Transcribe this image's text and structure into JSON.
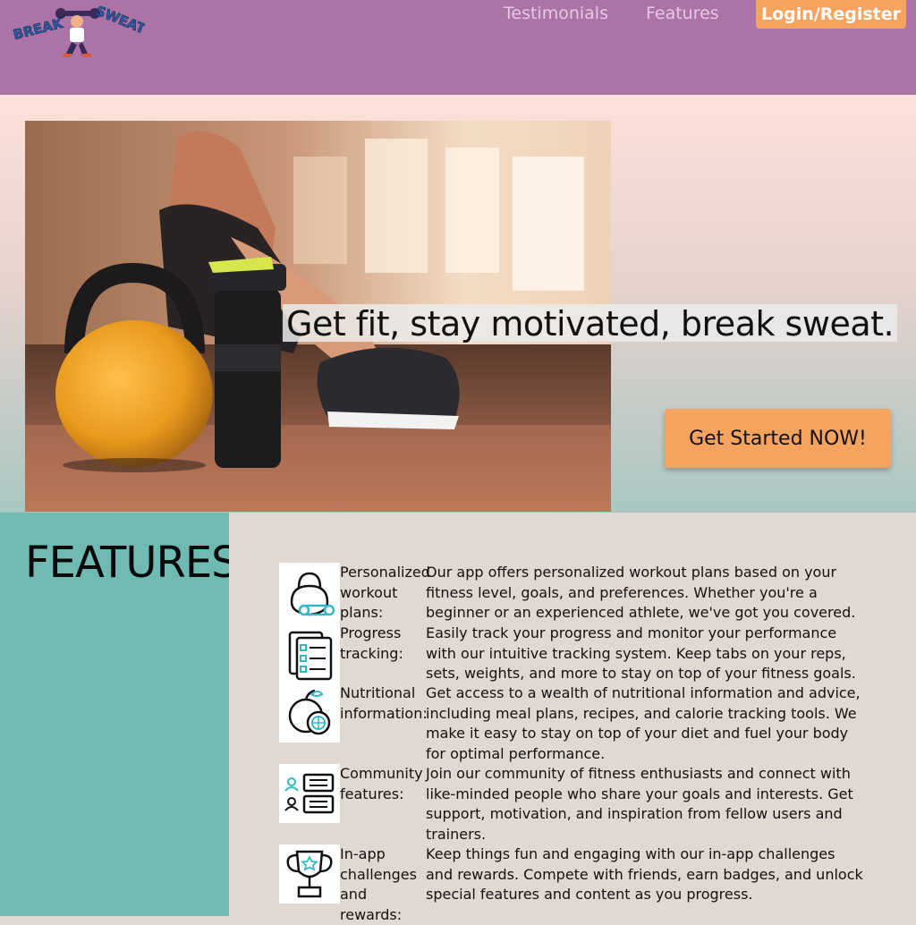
{
  "header": {
    "logo_text_left": "BREAK",
    "logo_text_right": "SWEAT",
    "nav": [
      {
        "label": "Testimonials"
      },
      {
        "label": "Features"
      }
    ],
    "login_label": "Login/Register",
    "accent_color": "#f5a35f",
    "bg_color": "#ab73a6"
  },
  "hero": {
    "tagline": "Get fit, stay motivated, break sweat.",
    "cta_label": "Get Started NOW!"
  },
  "features": {
    "title": "FEATURES",
    "items": [
      {
        "icon": "kettlebell-icon",
        "name": "Personalized workout plans:",
        "description": "Our app offers personalized workout plans based on your fitness level, goals, and preferences. Whether you're a beginner or an experienced athlete, we've got you covered."
      },
      {
        "icon": "clipboard-checklist-icon",
        "name": "Progress tracking:",
        "description": "Easily track your progress and monitor your performance with our intuitive tracking system. Keep tabs on your reps, sets, weights, and more to stay on top of your fitness goals."
      },
      {
        "icon": "fruit-icon",
        "name": "Nutritional information:",
        "description": "Get access to a wealth of nutritional information and advice, including meal plans, recipes, and calorie tracking tools. We make it easy to stay on top of your diet and fuel your body for optimal performance."
      },
      {
        "icon": "community-chat-icon",
        "name": "Community features:",
        "description": "Join our community of fitness enthusiasts and connect with like-minded people who share your goals and interests. Get support, motivation, and inspiration from fellow users and trainers."
      },
      {
        "icon": "trophy-icon",
        "name": "In-app challenges and rewards:",
        "description": "Keep things fun and engaging with our in-app challenges and rewards. Compete with friends, earn badges, and unlock special features and content as you progress."
      }
    ]
  }
}
